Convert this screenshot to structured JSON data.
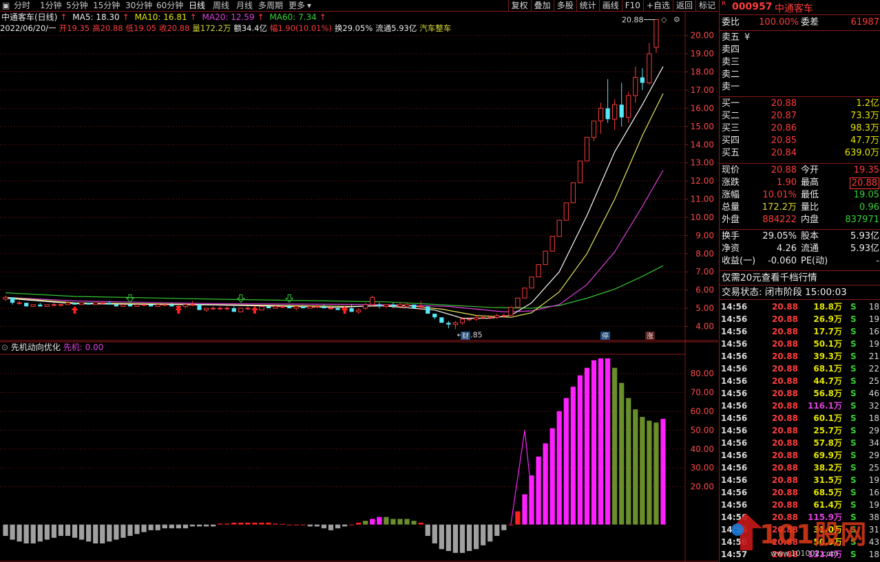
{
  "toolbar": {
    "periods": [
      "分时",
      "1分钟",
      "5分钟",
      "15分钟",
      "30分钟",
      "60分钟",
      "日线",
      "周线",
      "月线",
      "多周期",
      "更多"
    ],
    "active": "日线",
    "right_buttons": [
      "复权",
      "叠加",
      "多股",
      "统计",
      "画线",
      "F10",
      "+自选",
      "返回",
      "标记"
    ]
  },
  "header": {
    "name": "中通客车(日线)",
    "ma5_label": "MA5: 18.30",
    "ma10_label": "MA10: 16.81",
    "ma20_label": "MA20: 12.59",
    "ma60_label": "MA60: 7.34"
  },
  "bar": {
    "date": "2022/06/20/一",
    "open": "开19.35",
    "high": "高20.88",
    "low": "低19.05",
    "close": "收20.88",
    "vol": "量172.2万",
    "amt": "额34.4亿",
    "chg": "幅1.90(10.01%)",
    "turnover": "换29.05%",
    "float": "流通5.93亿",
    "sector": "汽车整车"
  },
  "indicator": {
    "name": "先机动向优化",
    "label": "先机: 0.00"
  },
  "chart_data": [
    {
      "type": "candlestick",
      "title": "中通客车(日线)",
      "y_ticks": [
        4,
        5,
        6,
        7,
        8,
        9,
        10,
        11,
        12,
        13,
        14,
        15,
        16,
        17,
        18,
        19,
        20
      ],
      "y_tick_labels": [
        "4.00",
        "5.00",
        "6.00",
        "7.00",
        "8.00",
        "9.00",
        "10.00",
        "11.00",
        "12.00",
        "13.00",
        "14.00",
        "15.00",
        "16.00",
        "17.00",
        "18.00",
        "19.00",
        "20.00"
      ],
      "ylim": [
        3.3,
        21.2
      ],
      "annotations": {
        "high_label": "20.88",
        "low_label": "3.85",
        "markers": [
          "财",
          "停",
          "涨"
        ]
      },
      "candles": [
        [
          5.5,
          5.7,
          5.4,
          5.6
        ],
        [
          5.6,
          5.6,
          5.2,
          5.3
        ],
        [
          5.3,
          5.4,
          5.2,
          5.3
        ],
        [
          5.3,
          5.3,
          5.1,
          5.1
        ],
        [
          5.1,
          5.2,
          5.1,
          5.2
        ],
        [
          5.2,
          5.3,
          5.1,
          5.1
        ],
        [
          5.1,
          5.2,
          5.1,
          5.2
        ],
        [
          5.2,
          5.3,
          5.1,
          5.2
        ],
        [
          5.2,
          5.2,
          5.1,
          5.2
        ],
        [
          5.2,
          5.3,
          5.2,
          5.3
        ],
        [
          5.3,
          5.3,
          5.2,
          5.2
        ],
        [
          5.2,
          5.3,
          5.2,
          5.3
        ],
        [
          5.3,
          5.3,
          5.2,
          5.2
        ],
        [
          5.2,
          5.3,
          5.2,
          5.3
        ],
        [
          5.3,
          5.3,
          5.2,
          5.3
        ],
        [
          5.3,
          5.4,
          5.2,
          5.2
        ],
        [
          5.2,
          5.2,
          5.1,
          5.1
        ],
        [
          5.1,
          5.2,
          5.1,
          5.2
        ],
        [
          5.2,
          5.2,
          5.1,
          5.1
        ],
        [
          5.1,
          5.2,
          5.1,
          5.2
        ],
        [
          5.2,
          5.2,
          5.1,
          5.2
        ],
        [
          5.2,
          5.2,
          5.1,
          5.1
        ],
        [
          5.1,
          5.2,
          5.1,
          5.2
        ],
        [
          5.2,
          5.2,
          5.1,
          5.2
        ],
        [
          5.2,
          5.3,
          5.1,
          5.1
        ],
        [
          5.1,
          5.2,
          5.1,
          5.1
        ],
        [
          5.1,
          5.2,
          5.0,
          5.2
        ],
        [
          5.2,
          5.4,
          5.1,
          5.2
        ],
        [
          5.2,
          5.2,
          4.9,
          4.9
        ],
        [
          4.9,
          5.0,
          4.8,
          5.0
        ],
        [
          5.0,
          5.1,
          4.9,
          5.0
        ],
        [
          5.0,
          5.1,
          4.9,
          5.0
        ],
        [
          5.0,
          5.1,
          4.9,
          5.0
        ],
        [
          5.0,
          5.1,
          4.8,
          4.8
        ],
        [
          4.8,
          5.0,
          4.8,
          5.0
        ],
        [
          5.0,
          5.1,
          4.9,
          5.0
        ],
        [
          5.0,
          5.1,
          4.9,
          4.9
        ],
        [
          4.9,
          5.1,
          4.9,
          5.1
        ],
        [
          5.1,
          5.1,
          5.0,
          5.0
        ],
        [
          5.0,
          5.2,
          5.0,
          5.1
        ],
        [
          5.1,
          5.1,
          5.0,
          5.1
        ],
        [
          5.1,
          5.2,
          5.0,
          5.0
        ],
        [
          5.0,
          5.1,
          4.9,
          5.1
        ],
        [
          5.1,
          5.1,
          5.0,
          5.0
        ],
        [
          5.0,
          5.1,
          5.0,
          5.1
        ],
        [
          5.1,
          5.2,
          5.0,
          5.1
        ],
        [
          5.1,
          5.2,
          5.0,
          5.0
        ],
        [
          5.0,
          5.1,
          5.0,
          5.0
        ],
        [
          5.0,
          5.1,
          4.9,
          4.9
        ],
        [
          4.9,
          5.0,
          4.9,
          5.0
        ],
        [
          5.0,
          5.2,
          4.8,
          4.8
        ],
        [
          4.8,
          5.0,
          4.7,
          4.9
        ],
        [
          5.0,
          5.3,
          4.9,
          5.2
        ],
        [
          5.2,
          5.7,
          5.1,
          5.6
        ],
        [
          5.2,
          5.3,
          5.0,
          5.1
        ],
        [
          5.1,
          5.2,
          5.0,
          5.2
        ],
        [
          5.2,
          5.3,
          5.0,
          5.1
        ],
        [
          5.1,
          5.3,
          5.0,
          5.2
        ],
        [
          5.1,
          5.3,
          5.0,
          5.2
        ],
        [
          5.2,
          5.2,
          5.0,
          5.0
        ],
        [
          5.1,
          5.4,
          4.9,
          5.1
        ],
        [
          5.1,
          5.1,
          4.7,
          4.7
        ],
        [
          4.7,
          4.7,
          4.4,
          4.5
        ],
        [
          4.5,
          4.5,
          4.2,
          4.2
        ],
        [
          4.2,
          4.3,
          3.9,
          4.1
        ],
        [
          4.1,
          4.3,
          3.85,
          4.2
        ],
        [
          4.2,
          4.5,
          4.1,
          4.4
        ],
        [
          4.4,
          4.5,
          4.3,
          4.4
        ],
        [
          4.4,
          4.6,
          4.3,
          4.5
        ],
        [
          4.5,
          4.6,
          4.4,
          4.5
        ],
        [
          4.5,
          4.6,
          4.4,
          4.5
        ],
        [
          4.5,
          4.7,
          4.4,
          4.6
        ],
        [
          4.6,
          4.7,
          4.5,
          4.6
        ],
        [
          4.6,
          5.1,
          4.6,
          5.05
        ],
        [
          5.05,
          5.56,
          5.05,
          5.56
        ],
        [
          5.56,
          6.11,
          5.56,
          6.11
        ],
        [
          6.11,
          6.72,
          6.11,
          6.72
        ],
        [
          6.72,
          7.4,
          6.72,
          7.4
        ],
        [
          7.4,
          8.14,
          7.4,
          8.14
        ],
        [
          8.14,
          8.95,
          8.14,
          8.95
        ],
        [
          8.95,
          9.84,
          8.95,
          9.84
        ],
        [
          9.84,
          10.8,
          9.84,
          10.8
        ],
        [
          10.8,
          11.9,
          10.8,
          11.9
        ],
        [
          11.9,
          13.1,
          11.9,
          13.1
        ],
        [
          13.1,
          14.4,
          13.1,
          14.4
        ],
        [
          14.4,
          15.3,
          14.2,
          15.3
        ],
        [
          15.3,
          16.3,
          14.6,
          16.0
        ],
        [
          16.0,
          17.6,
          15.2,
          15.4
        ],
        [
          15.4,
          16.5,
          14.8,
          16.2
        ],
        [
          16.2,
          17.4,
          15.0,
          15.5
        ],
        [
          15.5,
          16.9,
          15.2,
          16.7
        ],
        [
          16.7,
          18.3,
          16.3,
          17.7
        ],
        [
          17.7,
          18.2,
          17.0,
          17.4
        ],
        [
          17.4,
          19.6,
          17.3,
          19.0
        ],
        [
          19.35,
          20.88,
          19.05,
          20.88
        ]
      ],
      "ma5": [
        [
          0,
          5.55
        ],
        [
          10,
          5.25
        ],
        [
          30,
          5.18
        ],
        [
          48,
          5.05
        ],
        [
          54,
          5.15
        ],
        [
          62,
          4.9
        ],
        [
          66,
          4.45
        ],
        [
          70,
          4.45
        ],
        [
          73,
          4.6
        ],
        [
          76,
          5.3
        ],
        [
          80,
          7.0
        ],
        [
          84,
          10.1
        ],
        [
          88,
          13.6
        ],
        [
          92,
          16.2
        ],
        [
          95,
          18.3
        ]
      ],
      "ma10": [
        [
          0,
          5.6
        ],
        [
          10,
          5.3
        ],
        [
          30,
          5.2
        ],
        [
          50,
          5.1
        ],
        [
          58,
          5.15
        ],
        [
          63,
          4.95
        ],
        [
          68,
          4.6
        ],
        [
          73,
          4.5
        ],
        [
          76,
          4.75
        ],
        [
          80,
          5.9
        ],
        [
          84,
          8.0
        ],
        [
          88,
          11.0
        ],
        [
          92,
          14.5
        ],
        [
          95,
          16.81
        ]
      ],
      "ma20": [
        [
          0,
          5.6
        ],
        [
          10,
          5.4
        ],
        [
          30,
          5.25
        ],
        [
          55,
          5.2
        ],
        [
          64,
          5.1
        ],
        [
          72,
          4.8
        ],
        [
          76,
          4.85
        ],
        [
          80,
          5.2
        ],
        [
          84,
          6.3
        ],
        [
          88,
          8.1
        ],
        [
          92,
          10.6
        ],
        [
          95,
          12.59
        ]
      ],
      "ma60": [
        [
          0,
          5.85
        ],
        [
          10,
          5.65
        ],
        [
          30,
          5.5
        ],
        [
          55,
          5.35
        ],
        [
          70,
          5.05
        ],
        [
          76,
          5.0
        ],
        [
          80,
          5.15
        ],
        [
          84,
          5.55
        ],
        [
          88,
          6.05
        ],
        [
          92,
          6.75
        ],
        [
          95,
          7.34
        ]
      ]
    },
    {
      "type": "bar",
      "title": "先机动向优化",
      "y_ticks": [
        20,
        30,
        40,
        50,
        60,
        70,
        80
      ],
      "y_tick_labels": [
        "20.00",
        "30.00",
        "40.00",
        "50.00",
        "60.00",
        "70.00",
        "80.00"
      ],
      "ylim": [
        -18,
        92
      ],
      "values": [
        -6,
        -8,
        -9,
        -10,
        -10,
        -9,
        -8,
        -7,
        -6,
        -6,
        -7,
        -8,
        -9,
        -10,
        -10,
        -9,
        -8,
        -7,
        -6,
        -5,
        -4,
        -3,
        -3,
        -2,
        -2,
        -2,
        -2,
        -1,
        -1,
        -1,
        -1,
        0.5,
        0.5,
        1,
        1,
        1,
        1,
        1,
        1,
        0.5,
        0.3,
        0,
        0,
        0,
        -1,
        -1,
        -2,
        -3,
        -2,
        -1,
        0,
        1,
        2,
        3,
        4,
        4,
        3,
        3,
        3,
        2,
        1,
        -6,
        -10,
        -13,
        -14,
        -15,
        -15,
        -14,
        -13,
        -11,
        -9,
        -6,
        -3,
        0,
        7,
        16,
        26,
        36,
        43,
        51,
        60,
        67,
        73,
        79,
        83,
        87,
        88,
        88,
        83,
        75,
        67,
        61,
        57,
        55,
        54,
        56
      ]
    }
  ],
  "quote": {
    "code": "000957",
    "name": "中通客车",
    "wb_label": "委比",
    "wb_value": "100.00%",
    "wc_label": "委差",
    "wc_value": "61987",
    "asks": [
      {
        "label": "卖五",
        "price": "",
        "vol": "",
        "extra": "¥"
      },
      {
        "label": "卖四",
        "price": "",
        "vol": ""
      },
      {
        "label": "卖三",
        "price": "",
        "vol": ""
      },
      {
        "label": "卖二",
        "price": "",
        "vol": ""
      },
      {
        "label": "卖一",
        "price": "",
        "vol": ""
      }
    ],
    "bids": [
      {
        "label": "买一",
        "price": "20.88",
        "vol": "1.2亿"
      },
      {
        "label": "买二",
        "price": "20.87",
        "vol": "73.3万"
      },
      {
        "label": "买三",
        "price": "20.86",
        "vol": "98.3万"
      },
      {
        "label": "买四",
        "price": "20.85",
        "vol": "47.7万"
      },
      {
        "label": "买五",
        "price": "20.84",
        "vol": "639.0万"
      }
    ],
    "stats": [
      {
        "l1": "现价",
        "v1": "20.88",
        "l2": "今开",
        "v2": "19.35"
      },
      {
        "l1": "涨跌",
        "v1": "1.90",
        "l2": "最高",
        "v2": "20.88"
      },
      {
        "l1": "涨幅",
        "v1": "10.01%",
        "l2": "最低",
        "v2": "19.05"
      },
      {
        "l1": "总量",
        "v1": "172.2万",
        "l2": "量比",
        "v2": "0.96"
      },
      {
        "l1": "外盘",
        "v1": "884222",
        "l2": "内盘",
        "v2": "837971"
      }
    ],
    "stats2": [
      {
        "l1": "换手",
        "v1": "29.05%",
        "l2": "股本",
        "v2": "5.93亿"
      },
      {
        "l1": "净资",
        "v1": "4.26",
        "l2": "流通",
        "v2": "5.93亿"
      },
      {
        "l1": "收益(一)",
        "v1": "-0.060",
        "l2": "PE(动)",
        "v2": "-"
      }
    ],
    "promo": "仅需20元查看千档行情",
    "status": "交易状态: 闭市阶段 15:00:03",
    "ticks": [
      {
        "t": "14:56",
        "p": "20.88",
        "v": "18.8万",
        "s": "S",
        "n": "18"
      },
      {
        "t": "14:56",
        "p": "20.88",
        "v": "26.9万",
        "s": "S",
        "n": "19"
      },
      {
        "t": "14:56",
        "p": "20.88",
        "v": "17.7万",
        "s": "S",
        "n": "16"
      },
      {
        "t": "14:56",
        "p": "20.88",
        "v": "50.1万",
        "s": "S",
        "n": "19"
      },
      {
        "t": "14:56",
        "p": "20.88",
        "v": "39.3万",
        "s": "S",
        "n": "21"
      },
      {
        "t": "14:56",
        "p": "20.88",
        "v": "68.1万",
        "s": "S",
        "n": "22"
      },
      {
        "t": "14:56",
        "p": "20.88",
        "v": "44.7万",
        "s": "S",
        "n": "25"
      },
      {
        "t": "14:56",
        "p": "20.88",
        "v": "56.8万",
        "s": "S",
        "n": "46"
      },
      {
        "t": "14:56",
        "p": "20.88",
        "v": "116.1万",
        "s": "S",
        "n": "32"
      },
      {
        "t": "14:56",
        "p": "20.88",
        "v": "60.1万",
        "s": "S",
        "n": "18"
      },
      {
        "t": "14:56",
        "p": "20.88",
        "v": "25.7万",
        "s": "S",
        "n": "29"
      },
      {
        "t": "14:56",
        "p": "20.88",
        "v": "57.8万",
        "s": "S",
        "n": "34"
      },
      {
        "t": "14:56",
        "p": "20.88",
        "v": "69.9万",
        "s": "S",
        "n": "29"
      },
      {
        "t": "14:56",
        "p": "20.88",
        "v": "38.2万",
        "s": "S",
        "n": "25"
      },
      {
        "t": "14:56",
        "p": "20.88",
        "v": "31.5万",
        "s": "S",
        "n": "19"
      },
      {
        "t": "14:56",
        "p": "20.88",
        "v": "68.5万",
        "s": "S",
        "n": "16"
      },
      {
        "t": "14:56",
        "p": "20.88",
        "v": "61.4万",
        "s": "S",
        "n": "19"
      },
      {
        "t": "14:56",
        "p": "20.88",
        "v": "115.9万",
        "s": "S",
        "n": "38"
      },
      {
        "t": "14:56",
        "p": "20.88",
        "v": "31.0万",
        "s": "S",
        "n": "31"
      },
      {
        "t": "14:56",
        "p": "20.88",
        "v": "50.9万",
        "s": "S",
        "n": "43"
      },
      {
        "t": "14:57",
        "p": "20.88",
        "v": "131.4万",
        "s": "S",
        "n": "18"
      }
    ]
  },
  "watermark": {
    "text": "101股网",
    "url": "www.101002.com"
  },
  "colors": {
    "up": "#ff3c3c",
    "down": "#54e8f8",
    "ma5": "#ffffff",
    "ma10": "#e8e860",
    "ma20": "#e040e0",
    "ma60": "#34c834",
    "grid": "#8a1a1a",
    "ind_up": "#ff20ff",
    "ind_dn": "#6a8e2a",
    "ind_neg": "#a0a0a0"
  }
}
